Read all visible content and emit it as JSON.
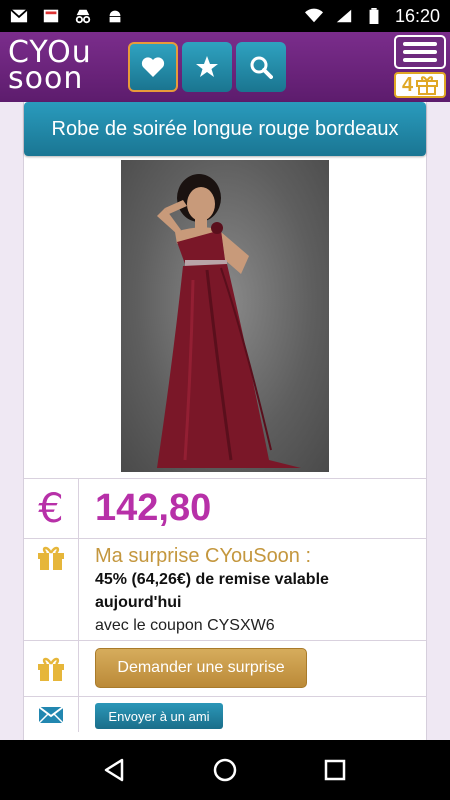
{
  "status_bar": {
    "time": "16:20",
    "left_icons": [
      "gmail-icon",
      "notification-icon",
      "incognito-icon",
      "android-icon"
    ],
    "right_icons": [
      "wifi-icon",
      "signal-icon",
      "battery-icon"
    ]
  },
  "header": {
    "logo_line1": "CYOu",
    "logo_line2": "soon",
    "buttons": [
      "heart-icon",
      "star-icon",
      "search-icon"
    ],
    "gift_count": "4"
  },
  "product": {
    "title": "Robe de soirée longue rouge bordeaux",
    "currency_symbol": "€",
    "price": "142,80",
    "surprise_title": "Ma surprise CYouSoon :",
    "surprise_line1": "45% (64,26€) de remise valable",
    "surprise_line2": "aujourd'hui",
    "surprise_coupon": "avec le coupon CYSXW6",
    "ask_button": "Demander une surprise",
    "send_button": "Envoyer à un ami"
  },
  "colors": {
    "brand_purple": "#6e2a7e",
    "accent_teal": "#1f86a6",
    "price_magenta": "#b730a8",
    "gold": "#c4973e"
  }
}
